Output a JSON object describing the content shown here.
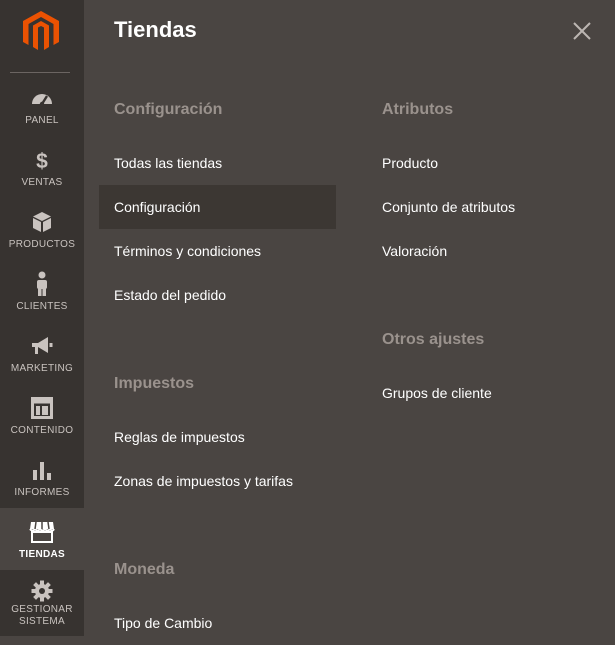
{
  "sidebar": {
    "items": [
      {
        "key": "panel",
        "label": "PANEL"
      },
      {
        "key": "ventas",
        "label": "VENTAS"
      },
      {
        "key": "productos",
        "label": "PRODUCTOS"
      },
      {
        "key": "clientes",
        "label": "CLIENTES"
      },
      {
        "key": "marketing",
        "label": "MARKETING"
      },
      {
        "key": "contenido",
        "label": "CONTENIDO"
      },
      {
        "key": "informes",
        "label": "INFORMES"
      },
      {
        "key": "tiendas",
        "label": "TIENDAS"
      },
      {
        "key": "sistema",
        "label_line1": "GESTIONAR",
        "label_line2": "SISTEMA"
      }
    ],
    "active": "TIENDAS"
  },
  "panel": {
    "title": "Tiendas",
    "sections": {
      "configuracion": {
        "title": "Configuración",
        "links": [
          "Todas las tiendas",
          "Configuración",
          "Términos y condiciones",
          "Estado del pedido"
        ],
        "current": "Configuración"
      },
      "impuestos": {
        "title": "Impuestos",
        "links": [
          "Reglas de impuestos",
          "Zonas de impuestos y tarifas"
        ]
      },
      "moneda": {
        "title": "Moneda",
        "links": [
          "Tipo de Cambio"
        ]
      },
      "atributos": {
        "title": "Atributos",
        "links": [
          "Producto",
          "Conjunto de atributos",
          "Valoración"
        ]
      },
      "otros": {
        "title": "Otros ajustes",
        "links": [
          "Grupos de cliente"
        ]
      }
    }
  },
  "colors": {
    "accent": "#eb5202",
    "sidebar_bg": "#373330",
    "panel_bg": "#4a4542",
    "section_title": "#9a928d"
  }
}
